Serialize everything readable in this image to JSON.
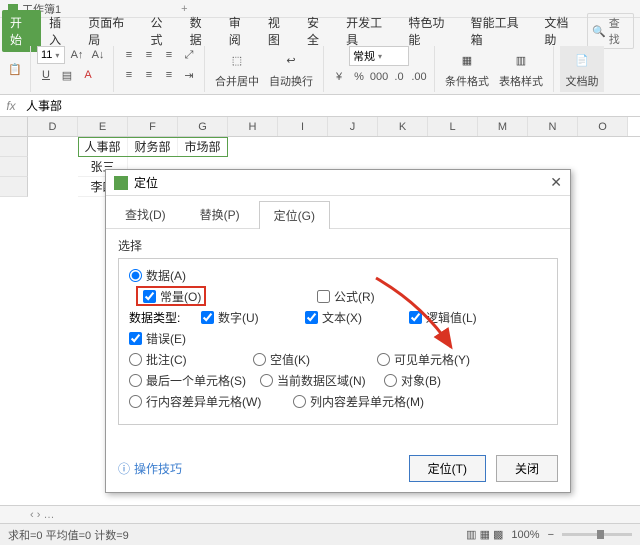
{
  "window": {
    "title": "工作簿1"
  },
  "ribbon": {
    "tabs": [
      "开始",
      "插入",
      "页面布局",
      "公式",
      "数据",
      "审阅",
      "视图",
      "安全",
      "开发工具",
      "特色功能",
      "智能工具箱",
      "文档助"
    ],
    "search_label": "查找",
    "font_size": "11",
    "number_format": "常规",
    "big_buttons": {
      "merge": "合并居中",
      "wrap": "自动换行",
      "cond": "条件格式",
      "table": "表格样式",
      "doc": "文档助"
    }
  },
  "formula": {
    "value": "人事部"
  },
  "columns": [
    "D",
    "E",
    "F",
    "G",
    "H",
    "I",
    "J",
    "K",
    "L",
    "M",
    "N",
    "O"
  ],
  "cells": {
    "E1": "人事部",
    "F1": "财务部",
    "G1": "市场部",
    "E2": "张三",
    "E3": "李四"
  },
  "dialog": {
    "title": "定位",
    "tabs": {
      "find": "查找(D)",
      "replace": "替换(P)",
      "goto": "定位(G)"
    },
    "section": "选择",
    "opts": {
      "data": "数据(A)",
      "constants": "常量(O)",
      "formulas": "公式(R)",
      "types_label": "数据类型:",
      "number": "数字(U)",
      "text": "文本(X)",
      "logical": "逻辑值(L)",
      "error": "错误(E)",
      "comments": "批注(C)",
      "blanks": "空值(K)",
      "visible": "可见单元格(Y)",
      "lastcell": "最后一个单元格(S)",
      "current_region": "当前数据区域(N)",
      "objects": "对象(B)",
      "row_diff": "行内容差异单元格(W)",
      "col_diff": "列内容差异单元格(M)"
    },
    "tips": "操作技巧",
    "ok": "定位(T)",
    "close": "关闭"
  },
  "status": {
    "text": "求和=0  平均值=0  计数=9",
    "zoom": "100%"
  }
}
